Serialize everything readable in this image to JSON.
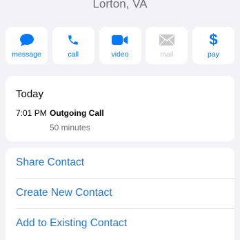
{
  "contact": {
    "location": "Lorton, VA"
  },
  "actions": [
    {
      "label": "message",
      "icon": "message-bubble-icon",
      "enabled": true
    },
    {
      "label": "call",
      "icon": "phone-icon",
      "enabled": true
    },
    {
      "label": "video",
      "icon": "video-camera-icon",
      "enabled": true
    },
    {
      "label": "mail",
      "icon": "envelope-icon",
      "enabled": false
    },
    {
      "label": "pay",
      "icon": "dollar-sign-icon",
      "enabled": true
    }
  ],
  "history": {
    "day": "Today",
    "time": "7:01 PM",
    "type": "Outgoing Call",
    "duration": "50 minutes"
  },
  "menu": {
    "share": "Share Contact",
    "create": "Create New Contact",
    "add": "Add to Existing Contact"
  },
  "colors": {
    "accent": "#007aff",
    "link": "#1f73d9",
    "disabled": "#c7c7cc",
    "background": "#f2f2f7",
    "secondary_text": "#6e6e73"
  }
}
